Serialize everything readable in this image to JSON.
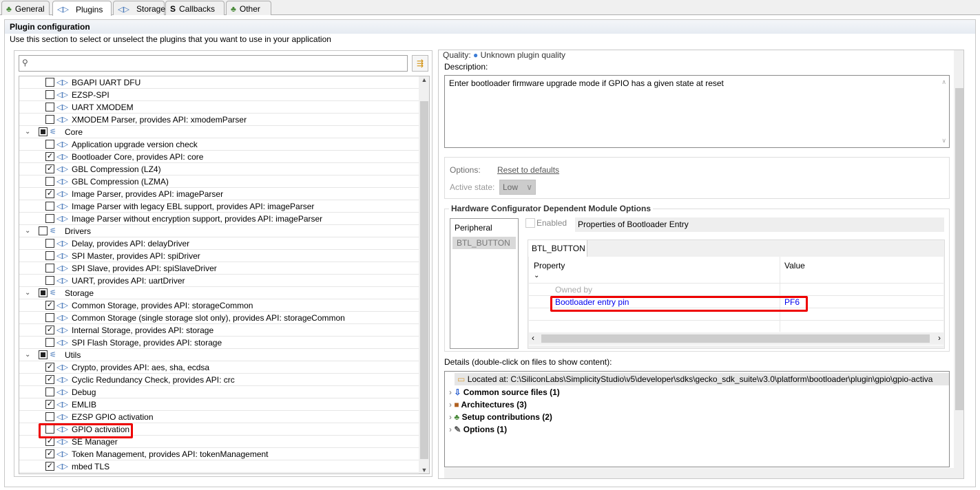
{
  "tabs": [
    {
      "label": "General",
      "icon": "cubes-icon"
    },
    {
      "label": "Plugins",
      "icon": "plugin-icon"
    },
    {
      "label": "Storage",
      "icon": "plugin-icon"
    },
    {
      "label": "Callbacks",
      "icon": "callback-icon"
    },
    {
      "label": "Other",
      "icon": "cubes-icon"
    }
  ],
  "section": {
    "title": "Plugin configuration",
    "subtitle": "Use this section to select or unselect the plugins that you want to use in your application"
  },
  "search": {
    "value": ""
  },
  "tree": [
    {
      "label": "BGAPI UART DFU",
      "type": "plugin",
      "state": "unchecked"
    },
    {
      "label": "EZSP-SPI",
      "type": "plugin",
      "state": "unchecked"
    },
    {
      "label": "UART XMODEM",
      "type": "plugin",
      "state": "unchecked"
    },
    {
      "label": "XMODEM Parser, provides API: xmodemParser",
      "type": "plugin",
      "state": "unchecked"
    },
    {
      "label": "Core",
      "type": "category",
      "state": "partial"
    },
    {
      "label": "Application upgrade version check",
      "type": "plugin",
      "state": "unchecked"
    },
    {
      "label": "Bootloader Core, provides API: core",
      "type": "plugin",
      "state": "checked"
    },
    {
      "label": "GBL Compression (LZ4)",
      "type": "plugin",
      "state": "checked"
    },
    {
      "label": "GBL Compression (LZMA)",
      "type": "plugin",
      "state": "unchecked"
    },
    {
      "label": "Image Parser, provides API: imageParser",
      "type": "plugin",
      "state": "checked"
    },
    {
      "label": "Image Parser with legacy EBL support, provides API: imageParser",
      "type": "plugin",
      "state": "unchecked"
    },
    {
      "label": "Image Parser without encryption support, provides API: imageParser",
      "type": "plugin",
      "state": "unchecked"
    },
    {
      "label": "Drivers",
      "type": "category",
      "state": "unchecked"
    },
    {
      "label": "Delay, provides API: delayDriver",
      "type": "plugin",
      "state": "unchecked"
    },
    {
      "label": "SPI Master, provides API: spiDriver",
      "type": "plugin",
      "state": "unchecked"
    },
    {
      "label": "SPI Slave, provides API: spiSlaveDriver",
      "type": "plugin",
      "state": "unchecked"
    },
    {
      "label": "UART, provides API: uartDriver",
      "type": "plugin",
      "state": "unchecked"
    },
    {
      "label": "Storage",
      "type": "category",
      "state": "partial"
    },
    {
      "label": "Common Storage, provides API: storageCommon",
      "type": "plugin",
      "state": "checked"
    },
    {
      "label": "Common Storage (single storage slot only), provides API: storageCommon",
      "type": "plugin",
      "state": "unchecked"
    },
    {
      "label": "Internal Storage, provides API: storage",
      "type": "plugin",
      "state": "checked"
    },
    {
      "label": "SPI Flash Storage, provides API: storage",
      "type": "plugin",
      "state": "unchecked"
    },
    {
      "label": "Utils",
      "type": "category",
      "state": "partial"
    },
    {
      "label": "Crypto, provides API: aes, sha, ecdsa",
      "type": "plugin",
      "state": "checked"
    },
    {
      "label": "Cyclic Redundancy Check, provides API: crc",
      "type": "plugin",
      "state": "checked"
    },
    {
      "label": "Debug",
      "type": "plugin",
      "state": "unchecked"
    },
    {
      "label": "EMLIB",
      "type": "plugin",
      "state": "checked"
    },
    {
      "label": "EZSP GPIO activation",
      "type": "plugin",
      "state": "unchecked"
    },
    {
      "label": "GPIO activation",
      "type": "plugin",
      "state": "unchecked",
      "selected": true
    },
    {
      "label": "SE Manager",
      "type": "plugin",
      "state": "checked"
    },
    {
      "label": "Token Management, provides API: tokenManagement",
      "type": "plugin",
      "state": "checked"
    },
    {
      "label": "mbed TLS",
      "type": "plugin",
      "state": "checked"
    }
  ],
  "details": {
    "quality_label": "Quality:",
    "quality_value": "Unknown plugin quality",
    "description_label": "Description:",
    "description": "Enter bootloader firmware upgrade mode if GPIO has a given state at reset",
    "options_label": "Options:",
    "reset_link": "Reset to defaults",
    "active_state_label": "Active state:",
    "active_state_value": "Low",
    "hw_title": "Hardware Configurator Dependent Module Options",
    "peripheral_header": "Peripheral",
    "peripheral_item": "BTL_BUTTON",
    "enabled_label": "Enabled",
    "properties_title": "Properties of Bootloader Entry",
    "hw_tab": "BTL_BUTTON",
    "col_property": "Property",
    "col_value": "Value",
    "owned_by": "Owned by",
    "prop_name": "Bootloader entry pin",
    "prop_value": "PF6",
    "files_label": "Details (double-click on files to show content):",
    "located": "Located at: C:\\SiliconLabs\\SimplicityStudio\\v5\\developer\\sdks\\gecko_sdk_suite\\v3.0\\platform\\bootloader\\plugin\\gpio\\gpio-activa",
    "file_nodes": [
      "Common source files (1)",
      "Architectures (3)",
      "Setup contributions (2)",
      "Options (1)"
    ]
  },
  "colors": {
    "highlight": "#e00000",
    "link": "#0000ee"
  }
}
